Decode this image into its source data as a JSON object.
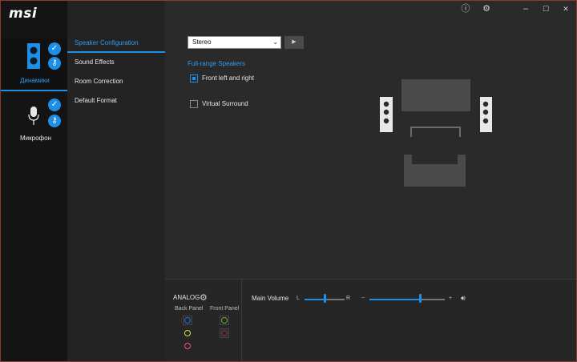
{
  "app": {
    "logo": "msi"
  },
  "window_controls": {
    "info": "ⓘ",
    "settings": "⚙",
    "minimize": "–",
    "maximize": "☐",
    "close": "✕"
  },
  "devices": [
    {
      "label": "Динамики",
      "active": true,
      "badge_check": "✓",
      "badge_plug": "⚷"
    },
    {
      "label": "Микрофон",
      "active": false,
      "badge_check": "✓",
      "badge_plug": "⚷"
    }
  ],
  "tabs": [
    {
      "label": "Speaker Configuration",
      "active": true
    },
    {
      "label": "Sound Effects",
      "active": false
    },
    {
      "label": "Room Correction",
      "active": false
    },
    {
      "label": "Default Format",
      "active": false
    }
  ],
  "config": {
    "select_value": "Stereo",
    "play_icon": "▶",
    "section_label": "Full-range Speakers",
    "front_lr_label": "Front left and right",
    "front_lr_checked": true,
    "virtual_surround_label": "Virtual Surround",
    "virtual_surround_checked": false
  },
  "bottom": {
    "analog_title": "ANALOG",
    "back_panel_label": "Back Panel",
    "front_panel_label": "Front Panel",
    "main_volume_label": "Main Volume",
    "balance_left": "L",
    "balance_right": "R",
    "volume_minus": "−",
    "volume_plus": "+",
    "balance_value": 0.5,
    "volume_value": 0.67,
    "jacks": [
      {
        "panel": "back",
        "color": "#1e6fd0"
      },
      {
        "panel": "back",
        "color": "#c8e63c"
      },
      {
        "panel": "back",
        "color": "#e85a8c"
      },
      {
        "panel": "front",
        "color": "#6ea33a"
      },
      {
        "panel": "front",
        "color": "#8a3a4a"
      }
    ]
  },
  "colors": {
    "accent": "#1e8fe6",
    "background": "#2a2a2a",
    "sidebar": "#141414"
  }
}
